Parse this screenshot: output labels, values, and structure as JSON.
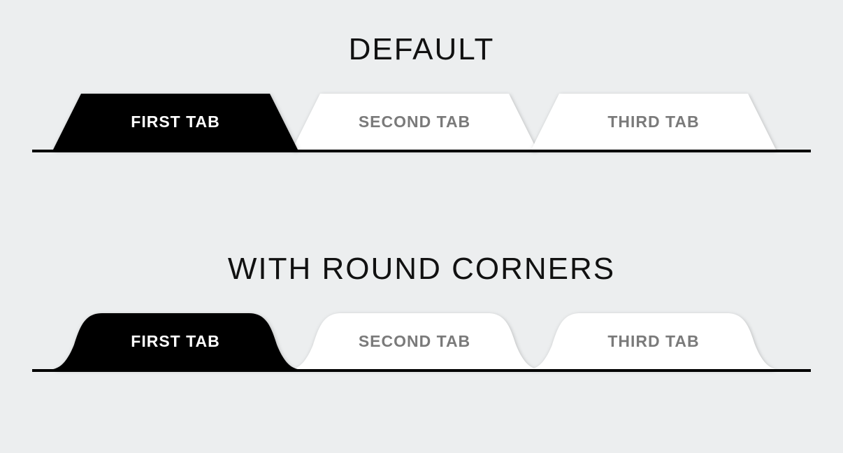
{
  "sections": {
    "default": {
      "heading": "DEFAULT",
      "tabs": [
        {
          "label": "FIRST TAB"
        },
        {
          "label": "SECOND TAB"
        },
        {
          "label": "THIRD TAB"
        }
      ]
    },
    "round": {
      "heading": "WITH ROUND CORNERS",
      "tabs": [
        {
          "label": "FIRST TAB"
        },
        {
          "label": "SECOND TAB"
        },
        {
          "label": "THIRD TAB"
        }
      ]
    }
  }
}
